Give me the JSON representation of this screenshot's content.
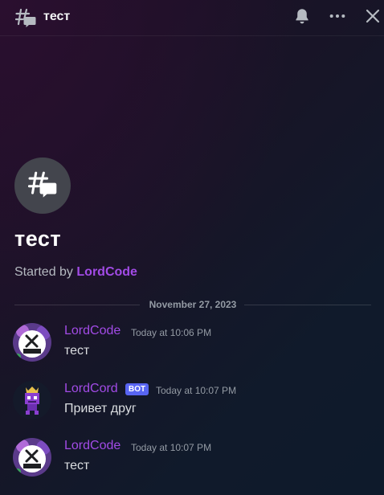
{
  "header": {
    "title": "тест",
    "icons": {
      "thread": "thread-icon",
      "bell": "bell-icon",
      "more": "more-icon",
      "close": "close-icon"
    }
  },
  "thread": {
    "name": "тест",
    "started_prefix": "Started by",
    "started_by": "LordCode"
  },
  "divider": {
    "date": "November 27, 2023"
  },
  "messages": [
    {
      "author": "LordCode",
      "time": "Today at 10:06 PM",
      "text": "тест",
      "bot": false
    },
    {
      "author": "LordCord",
      "bot_label": "BOT",
      "time": "Today at 10:07 PM",
      "text": "Привет друг",
      "bot": true
    },
    {
      "author": "LordCode",
      "time": "Today at 10:07 PM",
      "text": "тест",
      "bot": false
    }
  ],
  "colors": {
    "username": "#a24be6",
    "bot_badge": "#5865f2",
    "timestamp": "#949ba4",
    "message_text": "#dbdee1"
  }
}
